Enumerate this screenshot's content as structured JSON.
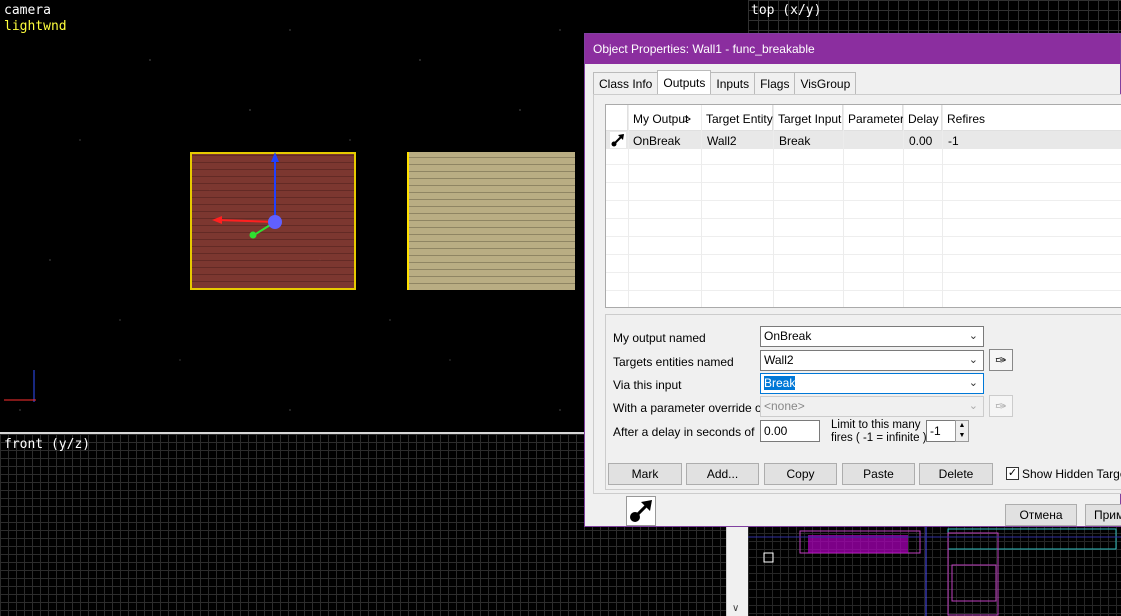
{
  "viewports": {
    "camera": {
      "label": "camera",
      "sublabel": "lightwnd"
    },
    "top": {
      "label": "top (x/y)"
    },
    "front": {
      "label": "front (y/z)"
    }
  },
  "dialog": {
    "title": "Object Properties: Wall1 - func_breakable",
    "tabs": [
      "Class Info",
      "Outputs",
      "Inputs",
      "Flags",
      "VisGroup"
    ],
    "active_tab": "Outputs",
    "grid": {
      "columns": [
        "My Output",
        ">",
        "Target Entity",
        "Target Input",
        "Parameter",
        "Delay",
        "Refires"
      ],
      "rows": [
        {
          "output": "OnBreak",
          "target": "Wall2",
          "input": "Break",
          "parameter": "",
          "delay": "0.00",
          "refires": "-1"
        }
      ]
    },
    "form": {
      "output_label": "My output named",
      "output_value": "OnBreak",
      "targets_label": "Targets entities named",
      "targets_value": "Wall2",
      "input_label": "Via this input",
      "input_value": "Break",
      "param_label": "With a parameter override of",
      "param_value": "<none>",
      "delay_label": "After a delay in seconds of",
      "delay_value": "0.00",
      "limit_label_1": "Limit to this many",
      "limit_label_2": "fires ( -1 = infinite )",
      "limit_value": "-1"
    },
    "buttons": {
      "mark": "Mark",
      "add": "Add...",
      "copy": "Copy",
      "paste": "Paste",
      "delete": "Delete"
    },
    "show_hidden": {
      "label": "Show Hidden Targets",
      "checked": true
    },
    "footer": {
      "cancel": "Отмена",
      "apply": "Прим"
    }
  }
}
